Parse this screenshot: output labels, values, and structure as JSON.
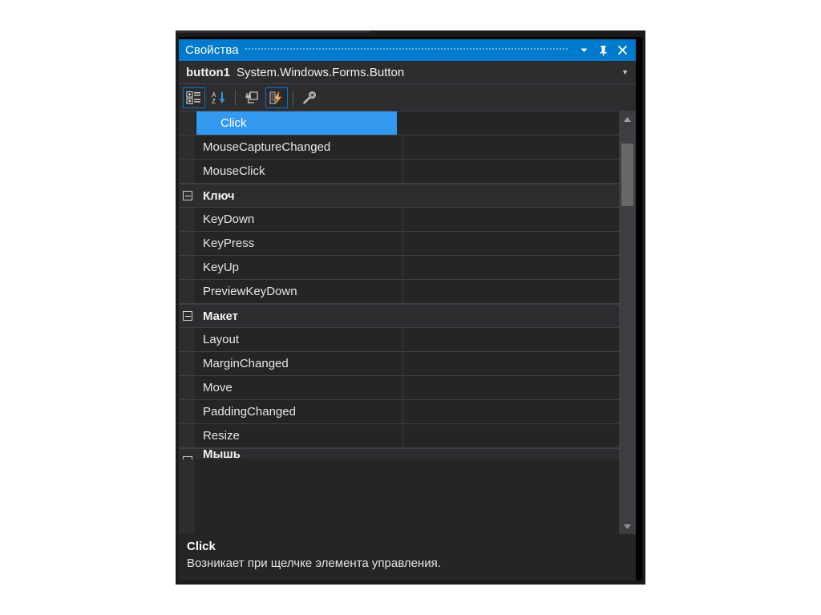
{
  "window": {
    "title": "Свойства",
    "title_buttons": [
      {
        "name": "window-menu-icon",
        "glyph": "chevron-down"
      },
      {
        "name": "pin-icon",
        "glyph": "pin"
      },
      {
        "name": "close-icon",
        "glyph": "close"
      }
    ]
  },
  "object_selector": {
    "name": "button1",
    "type": "System.Windows.Forms.Button",
    "caret": "▼"
  },
  "toolbar": {
    "buttons": [
      {
        "name": "categorized-view-button",
        "icon": "categorized-icon",
        "active": true
      },
      {
        "name": "alphabetical-view-button",
        "icon": "sort-alpha-icon",
        "active": false
      },
      {
        "name": "properties-button",
        "icon": "properties-plug-icon",
        "active": false
      },
      {
        "name": "events-button",
        "icon": "events-lightning-icon",
        "active": true
      },
      {
        "name": "property-pages-button",
        "icon": "property-pages-key-icon",
        "active": false
      }
    ]
  },
  "grid": {
    "rows": [
      {
        "kind": "property",
        "label": "Click",
        "value": "",
        "selected": true,
        "has_dropdown": true
      },
      {
        "kind": "property",
        "label": "MouseCaptureChanged",
        "value": "",
        "selected": false,
        "has_dropdown": false
      },
      {
        "kind": "property",
        "label": "MouseClick",
        "value": "",
        "selected": false,
        "has_dropdown": false
      },
      {
        "kind": "category",
        "label": "Ключ",
        "expanded": true
      },
      {
        "kind": "property",
        "label": "KeyDown",
        "value": "",
        "selected": false,
        "has_dropdown": false
      },
      {
        "kind": "property",
        "label": "KeyPress",
        "value": "",
        "selected": false,
        "has_dropdown": false
      },
      {
        "kind": "property",
        "label": "KeyUp",
        "value": "",
        "selected": false,
        "has_dropdown": false
      },
      {
        "kind": "property",
        "label": "PreviewKeyDown",
        "value": "",
        "selected": false,
        "has_dropdown": false
      },
      {
        "kind": "category",
        "label": "Макет",
        "expanded": true
      },
      {
        "kind": "property",
        "label": "Layout",
        "value": "",
        "selected": false,
        "has_dropdown": false
      },
      {
        "kind": "property",
        "label": "MarginChanged",
        "value": "",
        "selected": false,
        "has_dropdown": false
      },
      {
        "kind": "property",
        "label": "Move",
        "value": "",
        "selected": false,
        "has_dropdown": false
      },
      {
        "kind": "property",
        "label": "PaddingChanged",
        "value": "",
        "selected": false,
        "has_dropdown": false
      },
      {
        "kind": "property",
        "label": "Resize",
        "value": "",
        "selected": false,
        "has_dropdown": false
      },
      {
        "kind": "category",
        "label": "Мышь",
        "expanded": true,
        "clipped": true
      }
    ]
  },
  "scrollbar": {
    "up_arrow": "▲",
    "down_arrow": "▼"
  },
  "description": {
    "title": "Click",
    "text": "Возникает при щелчке элемента управления."
  },
  "colors": {
    "accent": "#007acc",
    "selection": "#3399ef",
    "panel_bg": "#252526",
    "chrome_bg": "#2d2d30",
    "frame": "#1b1b1c",
    "grid_line": "#3f3f46",
    "text": "#e6e6e6"
  }
}
